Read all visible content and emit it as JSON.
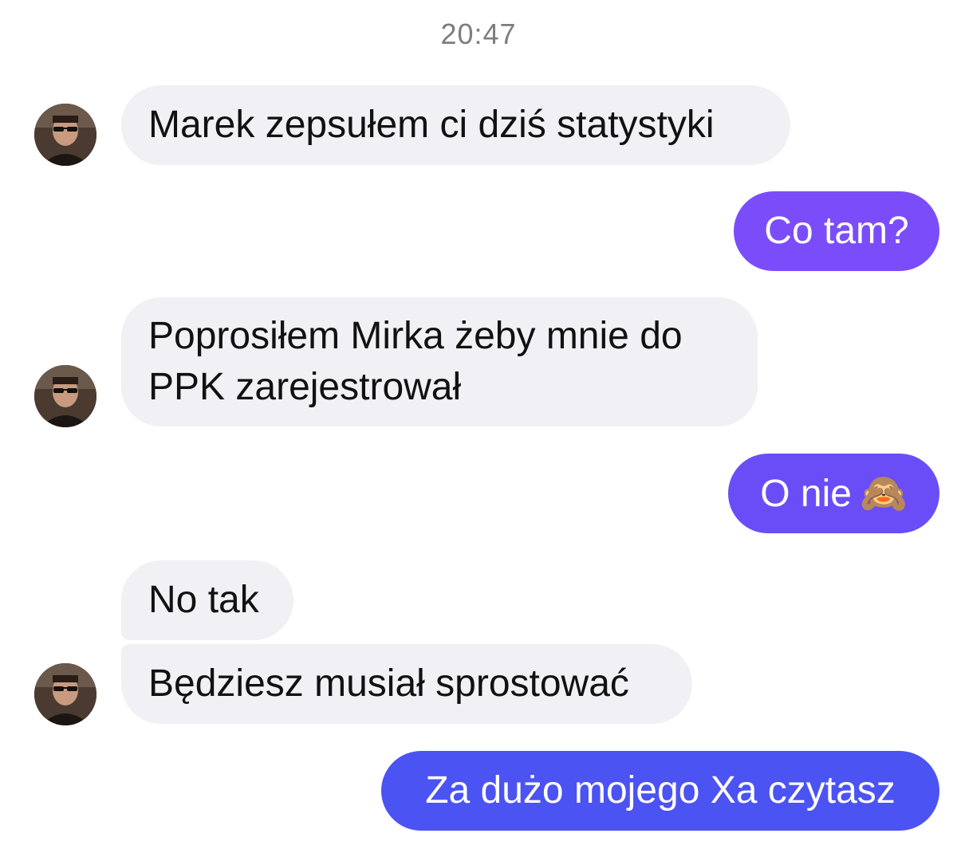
{
  "thread": {
    "timestamp": "20:47"
  },
  "colors": {
    "incoming_bubble": "#f0f0f5",
    "outgoing_top": "#7b4dfa",
    "outgoing_mid": "#6a4df7",
    "outgoing_bottom": "#4b53f2",
    "timestamp_text": "#7d7d82"
  },
  "messages": [
    {
      "direction": "incoming",
      "text": "Marek zepsułem ci dziś statystyki"
    },
    {
      "direction": "outgoing",
      "text": "Co tam?"
    },
    {
      "direction": "incoming",
      "lines": [
        "Poprosiłem Mirka żeby mnie do",
        "PPK zarejestrował"
      ]
    },
    {
      "direction": "outgoing",
      "text": "O nie",
      "emoji": "🙈",
      "emoji_name": "see-no-evil-monkey-icon"
    },
    {
      "direction": "incoming",
      "text": "No tak"
    },
    {
      "direction": "incoming",
      "text": "Będziesz musiał sprostować"
    },
    {
      "direction": "outgoing",
      "text": "Za dużo mojego Xa czytasz"
    }
  ],
  "avatar": {
    "icon": "contact-avatar-icon"
  }
}
